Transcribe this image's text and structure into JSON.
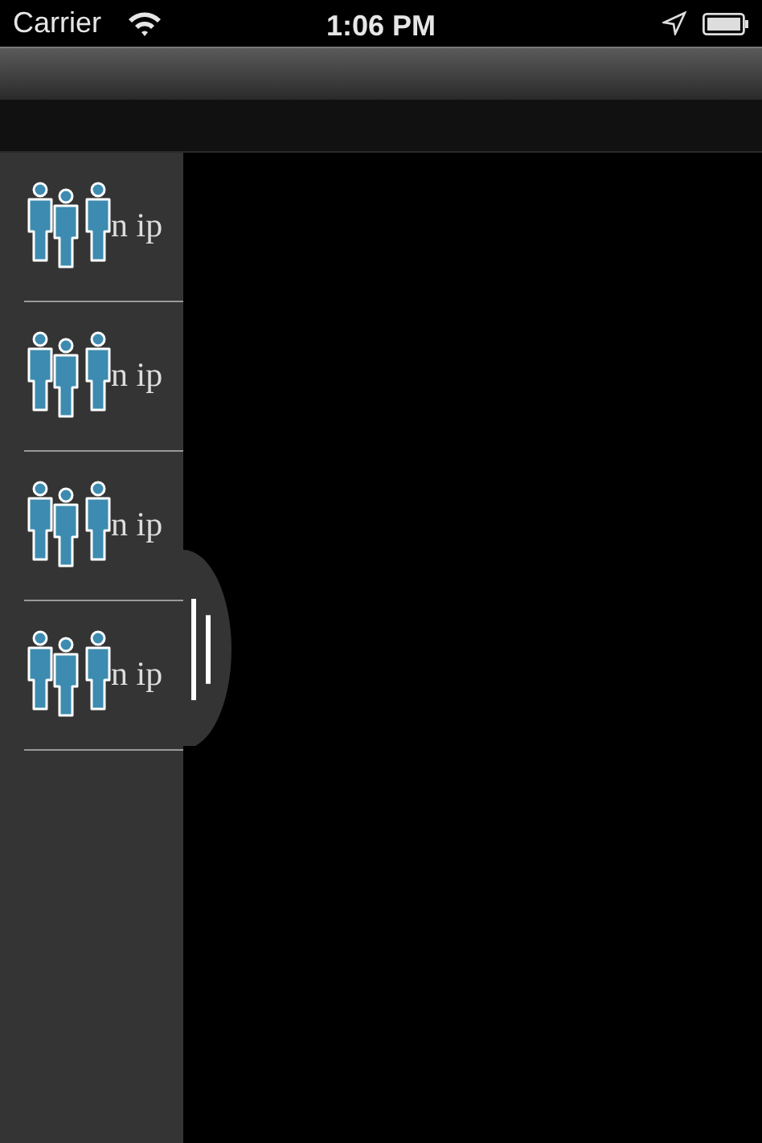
{
  "status_bar": {
    "carrier": "Carrier",
    "time": "1:06 PM"
  },
  "sidebar": {
    "items": [
      {
        "label": "n ip"
      },
      {
        "label": "n ip"
      },
      {
        "label": "n ip"
      },
      {
        "label": "n ip"
      }
    ]
  }
}
